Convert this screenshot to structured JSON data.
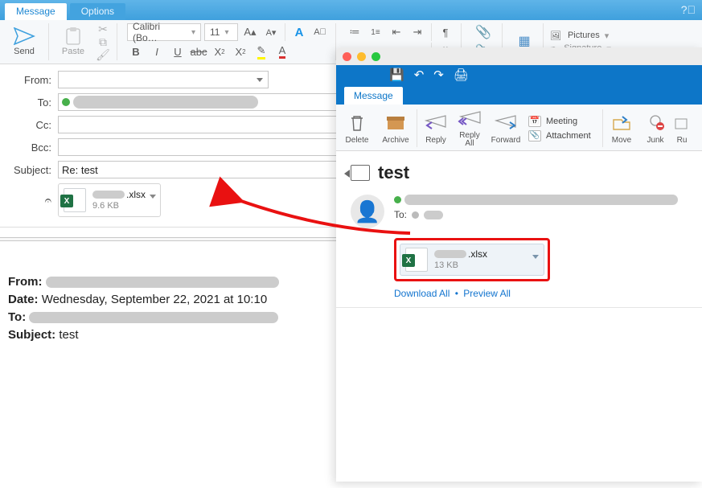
{
  "title_tabs": {
    "message": "Message",
    "options": "Options"
  },
  "ribbon": {
    "send": "Send",
    "paste": "Paste",
    "font_name": "Calibri (Bo…",
    "font_size": "11",
    "pictures": "Pictures",
    "signature": "Signature"
  },
  "fields": {
    "from": "From:",
    "to": "To:",
    "cc": "Cc:",
    "bcc": "Bcc:",
    "subject_label": "Subject:",
    "subject_value": "Re: test"
  },
  "attachment": {
    "ext": ".xlsx",
    "size": "9.6 KB"
  },
  "quoted": {
    "from_label": "From:",
    "date_label": "Date:",
    "date_value": "Wednesday, September 22, 2021 at 10:10",
    "to_label": "To:",
    "subject_label": "Subject:",
    "subject_value": "test"
  },
  "reader": {
    "tab": "Message",
    "buttons": {
      "delete": "Delete",
      "archive": "Archive",
      "reply": "Reply",
      "reply_all": "Reply\nAll",
      "forward": "Forward",
      "meeting": "Meeting",
      "attachment": "Attachment",
      "move": "Move",
      "junk": "Junk",
      "rules": "Ru"
    },
    "subject": "test",
    "to_label": "To:",
    "attachment": {
      "ext": ".xlsx",
      "size": "13 KB"
    },
    "download_all": "Download All",
    "preview_all": "Preview All"
  }
}
